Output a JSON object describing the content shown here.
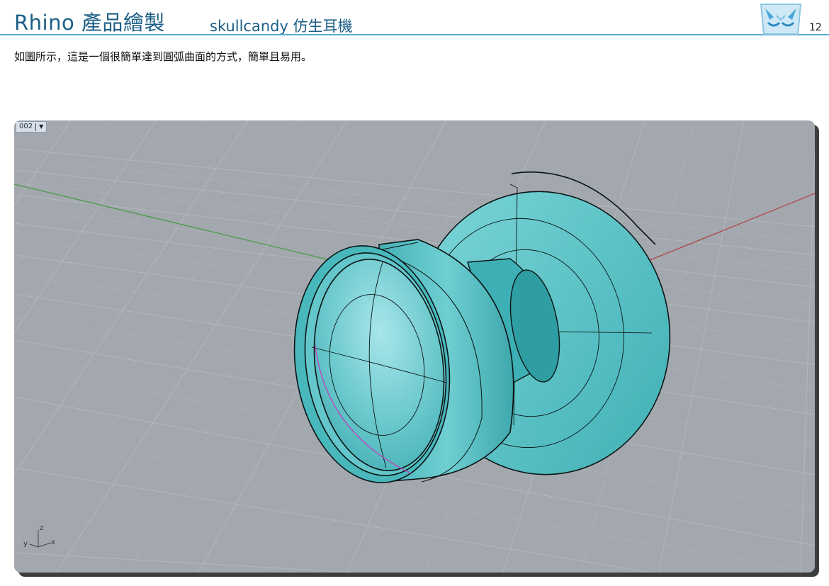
{
  "header": {
    "title": "Rhino 產品繪製",
    "subtitle": "skullcandy 仿生耳機",
    "page_number": "12"
  },
  "caption": "如圖所示，這是一個很簡單達到圓弧曲面的方式，簡單且易用。",
  "viewport": {
    "label": "002",
    "axis_x": "x",
    "axis_y": "y",
    "axis_z": "z"
  },
  "colors": {
    "title": "#1d5f86",
    "rule": "#5aaed2",
    "viewport_bg": "#a3a8ae",
    "grid": "#b5bac0",
    "model": "#5cc4c8",
    "x_axis": "#b04848",
    "y_axis": "#4a9a4a"
  },
  "icons": {
    "logo": "owl-logo-icon",
    "dropdown": "chevron-down-icon"
  }
}
